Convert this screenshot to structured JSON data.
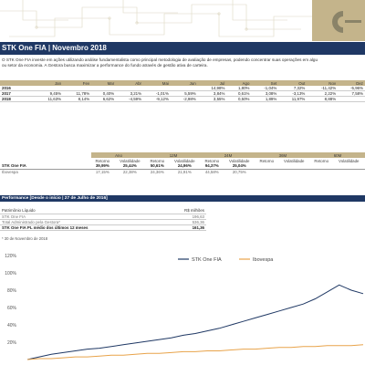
{
  "header": {
    "title": "STK One FIA | Novembro 2018",
    "brand_color": "#1f3864",
    "accent_color": "#c4b48b"
  },
  "description": [
    "O STK One FIA investe em ações utilizando análise fundamentalista como principal metodologia de avaliação de empresas, podendo concentrar suas operações em algu",
    "ou setor da economia. A Gestora busca maximizar a performance do fundo através de gestão ativa de carteira."
  ],
  "monthly": {
    "headers": [
      "",
      "Jan",
      "Fev",
      "Mar",
      "Abr",
      "Mai",
      "Jun",
      "Jul",
      "Ago",
      "Set",
      "Out",
      "Nov",
      "Dez"
    ],
    "rows": [
      {
        "year": "2016",
        "values": [
          "",
          "",
          "",
          "",
          "",
          "",
          "14,98%",
          "1,80%",
          "-1,04%",
          "7,32%",
          "-11,42%",
          "-5,96%"
        ]
      },
      {
        "year": "2017",
        "values": [
          "9,45%",
          "11,78%",
          "0,40%",
          "3,21%",
          "-1,01%",
          "5,59%",
          "3,84%",
          "0,61%",
          "3,08%",
          "-3,13%",
          "2,22%",
          "7,58%"
        ]
      },
      {
        "year": "2018",
        "values": [
          "11,63%",
          "8,14%",
          "6,62%",
          "-4,59%",
          "-9,12%",
          "-2,98%",
          "3,55%",
          "0,50%",
          "1,89%",
          "11,97%",
          "8,88%",
          ""
        ]
      }
    ]
  },
  "performance": {
    "groups": [
      "Ano",
      "12M",
      "24M",
      "36M",
      "60M"
    ],
    "sub_headers": [
      "Retorno",
      "Volatilidade"
    ],
    "rows": [
      {
        "name": "STK One FIA",
        "values": [
          "39,99%",
          "25,44%",
          "50,61%",
          "24,96%",
          "94,37%",
          "25,04%",
          "",
          "",
          "",
          ""
        ]
      },
      {
        "name": "Ibovespa",
        "values": [
          "17,15%",
          "22,38%",
          "24,36%",
          "21,91%",
          "44,58%",
          "20,75%",
          "",
          "",
          "",
          ""
        ]
      }
    ]
  },
  "section": {
    "title": "Performance  [Desde o início | 27 de Julho de 2016]"
  },
  "patrimonio": {
    "header": [
      "Patrimônio Líquido",
      "R$ milhões"
    ],
    "rows": [
      {
        "label": "STK One FIA",
        "value": "196,63",
        "style": "grey"
      },
      {
        "label": "Total Administrado pela Gestora*",
        "value": "536,36",
        "style": "grey"
      },
      {
        "label": "STK One FIA PL médio dos últimos 12 meses",
        "value": "161,36",
        "style": "strong"
      }
    ],
    "note": "* 30 de Novembro de 2018"
  },
  "chart_data": {
    "type": "line",
    "title": "",
    "xlabel": "",
    "ylabel": "",
    "ylim": [
      0,
      120
    ],
    "yticks": [
      "120%",
      "100%",
      "80%",
      "60%",
      "40%",
      "20%"
    ],
    "grid": false,
    "legend": "top",
    "colors": {
      "STK One FIA": "#1f3864",
      "Ibovespa": "#e8a34a"
    },
    "x": [
      0,
      1,
      2,
      3,
      4,
      5,
      6,
      7,
      8,
      9,
      10,
      11,
      12,
      13,
      14,
      15,
      16,
      17,
      18,
      19,
      20,
      21,
      22,
      23,
      24,
      25,
      26,
      27,
      28
    ],
    "series": [
      {
        "name": "STK One FIA",
        "values": [
          0,
          3,
          6,
          8,
          10,
          12,
          13,
          15,
          17,
          19,
          21,
          23,
          25,
          28,
          30,
          33,
          36,
          40,
          44,
          48,
          52,
          56,
          60,
          64,
          70,
          78,
          86,
          80,
          76
        ]
      },
      {
        "name": "Ibovespa",
        "values": [
          0,
          1,
          1,
          2,
          3,
          3,
          4,
          5,
          5,
          6,
          7,
          7,
          8,
          9,
          9,
          10,
          10,
          11,
          12,
          12,
          13,
          14,
          14,
          15,
          15,
          16,
          16,
          16,
          17
        ]
      }
    ]
  }
}
